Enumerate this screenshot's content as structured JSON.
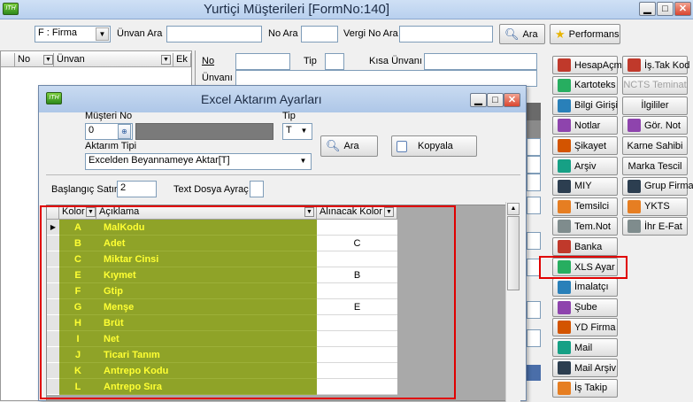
{
  "main": {
    "title": "Yurtiçi Müşterileri [FormNo:140]",
    "search": {
      "filter_select": "F : Firma",
      "unvan_ara_label": "Ünvan Ara",
      "no_ara_label": "No Ara",
      "vergi_no_ara_label": "Vergi No Ara",
      "ara_button": "Ara",
      "performans_button": "Performans"
    },
    "list_headers": {
      "no": "No",
      "unvan": "Ünvan",
      "ek": "Ek"
    },
    "detail": {
      "no_label": "No",
      "tip_label": "Tip",
      "kisa_unvan_label": "Kısa Ünvanı",
      "unvan_label": "Ünvanı"
    }
  },
  "side_left": [
    {
      "label": "HesapAçm",
      "icon": "handshake-icon"
    },
    {
      "label": "Kartoteks",
      "icon": "car-icon"
    },
    {
      "label": "Bilgi Girişi",
      "icon": "document-icon"
    },
    {
      "label": "Notlar",
      "icon": "notes-icon"
    },
    {
      "label": "Şikayet",
      "icon": "complaint-icon"
    },
    {
      "label": "Arşiv",
      "icon": "archive-icon"
    },
    {
      "label": "MIY",
      "icon": "globe-icon"
    },
    {
      "label": "Temsilci",
      "icon": "people-icon"
    },
    {
      "label": "Tem.Not",
      "icon": "people-note-icon"
    },
    {
      "label": "Banka",
      "icon": "bank-icon"
    },
    {
      "label": "XLS Ayar",
      "icon": "excel-icon"
    },
    {
      "label": "İmalatçı",
      "icon": "factory-icon"
    },
    {
      "label": "Şube",
      "icon": "branch-icon"
    },
    {
      "label": "YD Firma",
      "icon": "foreign-company-icon"
    },
    {
      "label": "Mail",
      "icon": "mail-icon"
    },
    {
      "label": "Mail Arşiv",
      "icon": "mail-archive-icon"
    },
    {
      "label": "İş Takip",
      "icon": "task-icon"
    }
  ],
  "side_right": [
    {
      "label": "İş.Tak Kod",
      "icon": "task-code-icon"
    },
    {
      "label": "NCTS Teminat",
      "icon": "none"
    },
    {
      "label": "İlgililer",
      "icon": "none"
    },
    {
      "label": "Gör. Not",
      "icon": "view-note-icon"
    },
    {
      "label": "Karne Sahibi",
      "icon": "none"
    },
    {
      "label": "Marka Tescil",
      "icon": "none"
    },
    {
      "label": "Grup Firma",
      "icon": "group-icon"
    },
    {
      "label": "YKTS",
      "icon": "check-icon"
    },
    {
      "label": "İhr E-Fat",
      "icon": "invoice-icon"
    }
  ],
  "dialog": {
    "title": "Excel Aktarım Ayarları",
    "musteri_no_label": "Müşteri No",
    "musteri_no_value": "0",
    "tip_label": "Tip",
    "tip_value": "T",
    "aktarim_tipi_label": "Aktarım Tipi",
    "aktarim_tipi_value": "Excelden Beyannameye Aktar[T]",
    "ara_button": "Ara",
    "kopyala_button": "Kopyala",
    "baslangic_satir_label": "Başlangıç Satır",
    "baslangic_satir_value": "2",
    "text_dosya_ayrac_label": "Text Dosya Ayraç",
    "text_dosya_ayrac_value": "",
    "grid_headers": {
      "kolor": "Kolor",
      "aciklama": "Açıklama",
      "alinacak_kolor": "Alınacak Kolor"
    },
    "grid_rows": [
      {
        "kolor": "A",
        "aciklama": "MalKodu",
        "alinacak": ""
      },
      {
        "kolor": "B",
        "aciklama": "Adet",
        "alinacak": "C"
      },
      {
        "kolor": "C",
        "aciklama": "Miktar Cinsi",
        "alinacak": ""
      },
      {
        "kolor": "E",
        "aciklama": "Kıymet",
        "alinacak": "B"
      },
      {
        "kolor": "F",
        "aciklama": "Gtip",
        "alinacak": ""
      },
      {
        "kolor": "G",
        "aciklama": "Menşe",
        "alinacak": "E"
      },
      {
        "kolor": "H",
        "aciklama": "Brüt",
        "alinacak": ""
      },
      {
        "kolor": "I",
        "aciklama": "Net",
        "alinacak": ""
      },
      {
        "kolor": "J",
        "aciklama": "Ticari Tanım",
        "alinacak": ""
      },
      {
        "kolor": "K",
        "aciklama": "Antrepo Kodu",
        "alinacak": ""
      },
      {
        "kolor": "L",
        "aciklama": "Antrepo Sıra",
        "alinacak": ""
      }
    ]
  },
  "colors": {
    "grid_green": "#8fa328",
    "grid_text_yellow": "#ffff33",
    "highlight_red": "#e00000"
  }
}
